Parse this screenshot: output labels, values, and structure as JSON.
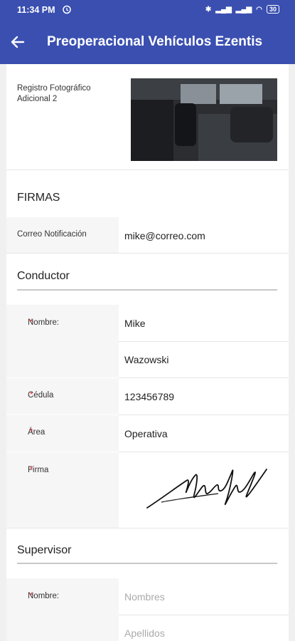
{
  "status_bar": {
    "time": "11:34 PM",
    "battery": "30"
  },
  "app_bar": {
    "title": "Preoperacional Vehículos Ezentis"
  },
  "photo_record": {
    "label_line1": "Registro Fotográfico",
    "label_line2": "Adicional 2"
  },
  "firmas": {
    "heading": "FIRMAS",
    "notification": {
      "label": "Correo Notificación",
      "value": "mike@correo.com"
    }
  },
  "conductor": {
    "heading": "Conductor",
    "name_label": "Nombre:",
    "first_name": "Mike",
    "last_name": "Wazowski",
    "cedula_label": "Cédula",
    "cedula": "123456789",
    "area_label": "Área",
    "area": "Operativa",
    "firma_label": "Firma"
  },
  "supervisor": {
    "heading": "Supervisor",
    "name_label": "Nombre:",
    "first_name_placeholder": "Nombres",
    "last_name_placeholder": "Apellidos"
  },
  "required_marker": "*"
}
